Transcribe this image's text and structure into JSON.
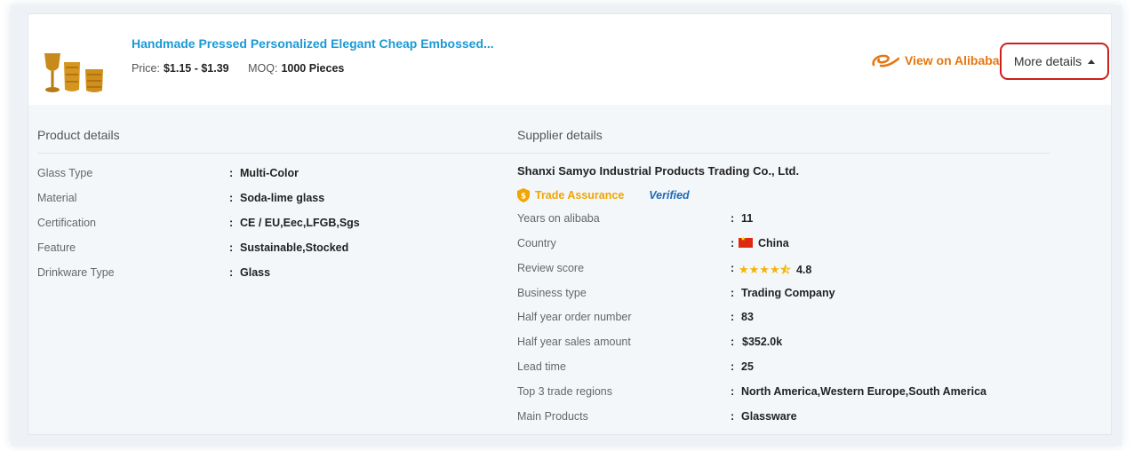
{
  "product": {
    "title": "Handmade Pressed Personalized Elegant Cheap Embossed...",
    "price_label": "Price:",
    "price_value": "$1.15 - $1.39",
    "moq_label": "MOQ:",
    "moq_value": "1000 Pieces"
  },
  "actions": {
    "view_on_alibaba": "View on Alibaba",
    "more_details": "More details"
  },
  "product_details": {
    "title": "Product details",
    "rows": [
      {
        "label": "Glass Type",
        "value": "Multi-Color"
      },
      {
        "label": "Material",
        "value": "Soda-lime glass"
      },
      {
        "label": "Certification",
        "value": "CE / EU,Eec,LFGB,Sgs"
      },
      {
        "label": "Feature",
        "value": "Sustainable,Stocked"
      },
      {
        "label": "Drinkware Type",
        "value": "Glass"
      }
    ]
  },
  "supplier_details": {
    "title": "Supplier details",
    "name": "Shanxi Samyo Industrial Products Trading Co., Ltd.",
    "trade_assurance": "Trade Assurance",
    "verified": "Verified",
    "rows": [
      {
        "label": "Years on alibaba",
        "value": "11"
      },
      {
        "label": "Country",
        "value": "China"
      },
      {
        "label": "Review score",
        "value": "4.8"
      },
      {
        "label": "Business type",
        "value": "Trading Company"
      },
      {
        "label": "Half year order number",
        "value": "83"
      },
      {
        "label": "Half year sales amount",
        "value": "$352.0k"
      },
      {
        "label": "Lead time",
        "value": "25"
      },
      {
        "label": "Top 3 trade regions",
        "value": "North America,Western Europe,South America"
      },
      {
        "label": "Main Products",
        "value": "Glassware"
      }
    ],
    "review_stars": 4.5
  },
  "colors": {
    "title_blue": "#1a9ad6",
    "alibaba_orange": "#e8760f",
    "highlight_red": "#cc1f1f",
    "trade_assurance_gold": "#f0a500",
    "verified_blue": "#1d69b8"
  }
}
